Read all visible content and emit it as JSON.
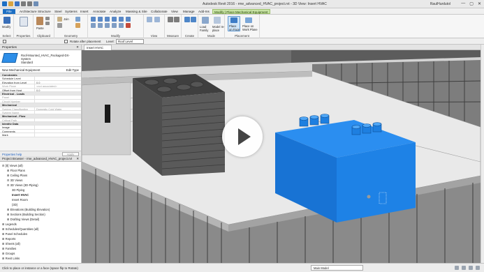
{
  "window": {
    "title": "Autodesk Revit 2016 - rme_advanced_HVAC_project.rvt - 3D View: Insert HVAC",
    "user": "RaulHurdutol",
    "controls": [
      "—",
      "▢",
      "✕"
    ]
  },
  "tabs": [
    {
      "label": "File"
    },
    {
      "label": "Architecture"
    },
    {
      "label": "Structure"
    },
    {
      "label": "Steel"
    },
    {
      "label": "Systems"
    },
    {
      "label": "Insert"
    },
    {
      "label": "Annotate"
    },
    {
      "label": "Analyze"
    },
    {
      "label": "Massing & Site"
    },
    {
      "label": "Collaborate"
    },
    {
      "label": "View"
    },
    {
      "label": "Manage"
    },
    {
      "label": "Add-Ins"
    },
    {
      "label": "Modify | Place Mechanical Equipment"
    }
  ],
  "ribbon": {
    "panels": [
      {
        "label": "Select"
      },
      {
        "label": "Properties"
      },
      {
        "label": "Clipboard"
      },
      {
        "label": "Geometry"
      },
      {
        "label": "Modify"
      },
      {
        "label": "View"
      },
      {
        "label": "Measure"
      },
      {
        "label": "Create"
      },
      {
        "label": "Mode"
      },
      {
        "label": "Placement"
      }
    ],
    "buttons": {
      "modify": "Modify",
      "paste": "Paste",
      "cut": "Cut",
      "join": "Join",
      "load_family": "Load Family",
      "model_in_place": "Model In-place",
      "place_on_face": "Place on Face",
      "place_on_work_plane": "Place on Work Plane"
    }
  },
  "options_bar": {
    "rotate_label": "Rotate after placement",
    "level_label": "Level:",
    "level_value": "Roof Level"
  },
  "properties": {
    "header": "Properties",
    "type_name_line1": "Roof-Mounted_HVAC_Packaged-DX-",
    "type_name_line2": "System",
    "type_name_line3": "Standard",
    "instance_label": "New Mechanical Equipment",
    "edit_type": "Edit Type",
    "rows": [
      {
        "k": "Constraints",
        "v": "",
        "grp": true
      },
      {
        "k": "Schedule Level",
        "v": ""
      },
      {
        "k": "Elevation from Level",
        "v": "0.0"
      },
      {
        "k": "Work Plane",
        "v": "<not associated>",
        "dim": true
      },
      {
        "k": "Offset from Host",
        "v": "0.0"
      },
      {
        "k": "Electrical - Loads",
        "v": "",
        "grp": true
      },
      {
        "k": "Panel",
        "v": "",
        "dim": true
      },
      {
        "k": "Circuit Number",
        "v": "",
        "dim": true
      },
      {
        "k": "Mechanical",
        "v": "",
        "grp": true
      },
      {
        "k": "System Classification",
        "v": "Domestic Cold Water",
        "dim": true
      },
      {
        "k": "System Name",
        "v": "",
        "dim": true
      },
      {
        "k": "Mechanical - Flow",
        "v": "",
        "grp": true
      },
      {
        "k": "Critical Path",
        "v": "",
        "dim": true
      },
      {
        "k": "Identity Data",
        "v": "",
        "grp": true
      },
      {
        "k": "Image",
        "v": ""
      },
      {
        "k": "Comments",
        "v": ""
      },
      {
        "k": "Mark",
        "v": ""
      }
    ],
    "help": "Properties help",
    "apply": "Apply"
  },
  "browser": {
    "header": "Project Browser - rme_advanced_HVAC_project.rvt",
    "items": [
      {
        "text": "⊟ [0] Views (all)",
        "indent": 0
      },
      {
        "text": "⊞ Floor Plans",
        "indent": 1
      },
      {
        "text": "⊞ Ceiling Plans",
        "indent": 1
      },
      {
        "text": "⊟ 3D Views",
        "indent": 1
      },
      {
        "text": "⊟ 3D Views (3D-Piping)",
        "indent": 1
      },
      {
        "text": "3D Piping",
        "indent": 2
      },
      {
        "text": "Insert HVAC",
        "indent": 2,
        "bold": true
      },
      {
        "text": "Insert Room",
        "indent": 2
      },
      {
        "text": "{3D}",
        "indent": 2
      },
      {
        "text": "⊞ Elevations (Building Elevation)",
        "indent": 1
      },
      {
        "text": "⊞ Sections (Building Section)",
        "indent": 1
      },
      {
        "text": "⊞ Drafting Views (Detail)",
        "indent": 1
      },
      {
        "text": "⊞ Legends",
        "indent": 0
      },
      {
        "text": "⊞ Schedules/Quantities (all)",
        "indent": 0
      },
      {
        "text": "⊞ Panel Schedules",
        "indent": 0
      },
      {
        "text": "⊞ Reports",
        "indent": 0
      },
      {
        "text": "⊞ Sheets (all)",
        "indent": 0
      },
      {
        "text": "⊞ Families",
        "indent": 0
      },
      {
        "text": "⊞ Groups",
        "indent": 0
      },
      {
        "text": "⊞ Revit Links",
        "indent": 0
      }
    ]
  },
  "view": {
    "tab": "Insert HVAC"
  },
  "status": {
    "text": "Click to place or instance or a face (space flip to Rotate)",
    "model": "Main Model"
  },
  "colors": {
    "accent": "#1d6fc4",
    "context_tab": "#c9e4a6",
    "hvac_blue": "#1e7fe0",
    "hvac_gray": "#4a4a4a"
  }
}
